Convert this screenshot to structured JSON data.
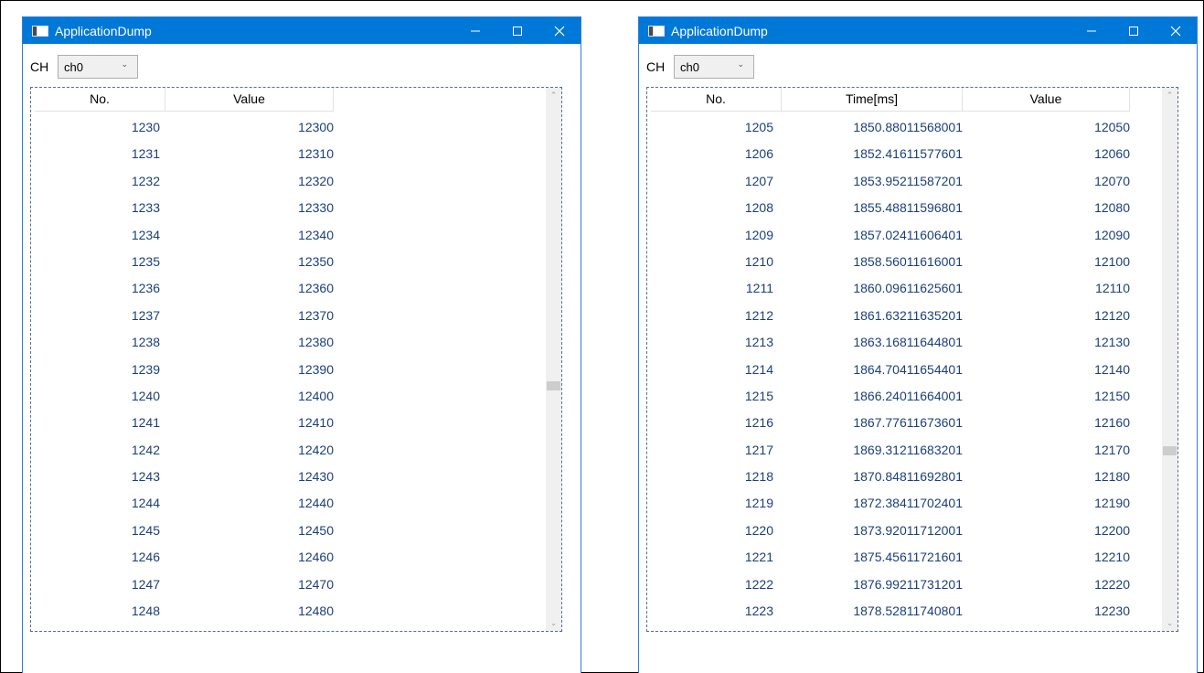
{
  "windows": [
    {
      "title": "ApplicationDump",
      "ch_label": "CH",
      "channel": "ch0",
      "columns": [
        "No.",
        "Value"
      ],
      "rows": [
        [
          "1230",
          "12300"
        ],
        [
          "1231",
          "12310"
        ],
        [
          "1232",
          "12320"
        ],
        [
          "1233",
          "12330"
        ],
        [
          "1234",
          "12340"
        ],
        [
          "1235",
          "12350"
        ],
        [
          "1236",
          "12360"
        ],
        [
          "1237",
          "12370"
        ],
        [
          "1238",
          "12380"
        ],
        [
          "1239",
          "12390"
        ],
        [
          "1240",
          "12400"
        ],
        [
          "1241",
          "12410"
        ],
        [
          "1242",
          "12420"
        ],
        [
          "1243",
          "12430"
        ],
        [
          "1244",
          "12440"
        ],
        [
          "1245",
          "12450"
        ],
        [
          "1246",
          "12460"
        ],
        [
          "1247",
          "12470"
        ],
        [
          "1248",
          "12480"
        ]
      ],
      "scroll_fraction": 0.55
    },
    {
      "title": "ApplicationDump",
      "ch_label": "CH",
      "channel": "ch0",
      "columns": [
        "No.",
        "Time[ms]",
        "Value"
      ],
      "rows": [
        [
          "1205",
          "1850.88011568001",
          "12050"
        ],
        [
          "1206",
          "1852.41611577601",
          "12060"
        ],
        [
          "1207",
          "1853.95211587201",
          "12070"
        ],
        [
          "1208",
          "1855.48811596801",
          "12080"
        ],
        [
          "1209",
          "1857.02411606401",
          "12090"
        ],
        [
          "1210",
          "1858.56011616001",
          "12100"
        ],
        [
          "1211",
          "1860.09611625601",
          "12110"
        ],
        [
          "1212",
          "1861.63211635201",
          "12120"
        ],
        [
          "1213",
          "1863.16811644801",
          "12130"
        ],
        [
          "1214",
          "1864.70411654401",
          "12140"
        ],
        [
          "1215",
          "1866.24011664001",
          "12150"
        ],
        [
          "1216",
          "1867.77611673601",
          "12160"
        ],
        [
          "1217",
          "1869.31211683201",
          "12170"
        ],
        [
          "1218",
          "1870.84811692801",
          "12180"
        ],
        [
          "1219",
          "1872.38411702401",
          "12190"
        ],
        [
          "1220",
          "1873.92011712001",
          "12200"
        ],
        [
          "1221",
          "1875.45611721601",
          "12210"
        ],
        [
          "1222",
          "1876.99211731201",
          "12220"
        ],
        [
          "1223",
          "1878.52811740801",
          "12230"
        ]
      ],
      "scroll_fraction": 0.68
    }
  ],
  "icons": {
    "minimize": "minimize-icon",
    "maximize": "maximize-icon",
    "close": "close-icon",
    "dropdown": "chevron-down-icon",
    "scroll_up": "chevron-up-icon",
    "scroll_down": "chevron-down-icon"
  },
  "colors": {
    "titlebar": "#0078d7",
    "cell_text": "#1a3f7a"
  }
}
